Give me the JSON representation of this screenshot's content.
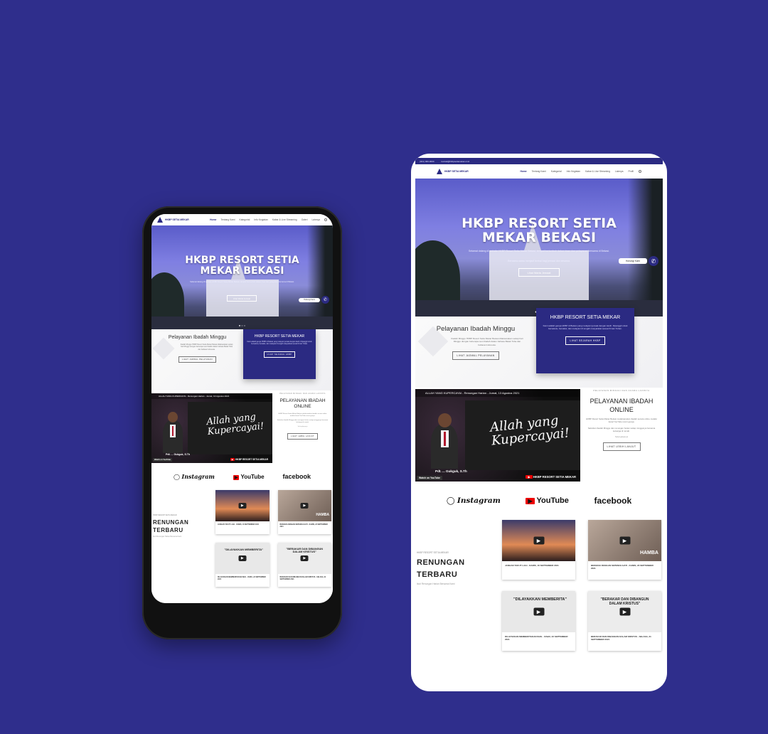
{
  "topbar": {
    "phone": "(021) 000-0000",
    "email": "kontak@hkbpsetiamekar.or.id"
  },
  "nav": {
    "logo": "HKBP SETIA MEKAR",
    "items": [
      "Home",
      "Tentang Kami",
      "Kategorial",
      "Info Kegiatan",
      "Renungan",
      "Kabar & Live Streaming",
      "Galeri",
      "Lainnya"
    ],
    "tablet_items": [
      "Home",
      "Tentang Kami",
      "Kategorial",
      "Info Kegiatan",
      "Kabar & Live Streaming",
      "Lainnya",
      "Profil"
    ]
  },
  "hero": {
    "title_line1": "HKBP RESORT SETIA",
    "title_line2": "MEKAR BEKASI",
    "subtitle": "Selamat datang di website HKBP Resort Setia Mekar Bekasi, tempat bertumbuh dalam iman dan pelayanan bersama di Bekasi.",
    "sub2": "Bersama-sama menjadi berkat bagi jemaat dan sesama.",
    "button": "Lihat Warta Jemaat",
    "whatsapp": "Hubungi Kami"
  },
  "service": {
    "left_title": "Pelayanan Ibadah Minggu",
    "left_text": "Ibadah Minggu HKBP Resort Setia Mekar Bekasi dilaksanakan setiap hari Minggu dengan beberapa sesi ibadah dalam bahasa Batak Toba dan bahasa Indonesia.",
    "left_button": "LIHAT JADWAL PELAYANAN",
    "card_title": "HKBP RESORT SETIA MEKAR",
    "card_text": "Kami adalah gereja HKBP di Bekasi yang melayani jemaat dengan kasih. Dipanggil untuk bersekutu, bersaksi, dan melayani di tengah masyarakat sesuai firman Tuhan.",
    "card_button": "LIHAT SEJARAH HKBP"
  },
  "video": {
    "title": "ALLAH YANG KUPERCAYAI  -  Renungan Harian - Jumat, 13 Agustus 2021",
    "script_line1": "Allah yang",
    "script_line2": "Kupercayai!",
    "speaker": "Pdt. ... Gukguk, S.Th",
    "channel": "HKBP RESORT SETIA MEKAR",
    "watch_on": "Watch on",
    "youtube": "YouTube"
  },
  "online": {
    "kicker": "PELAYANAN MINGGU DAN ACARA LAINNYA",
    "title_line1": "PELAYANAN IBADAH",
    "title_line2": "ONLINE",
    "text1": "HKBP Resort Setia Mekar Bekasi melaksanakan ibadah secara online melalui kanal YouTube resmi gereja.",
    "text2": "Saksikan ibadah Minggu dan renungan harian setiap minggunya bersama keluarga di rumah.",
    "label": "Selengkapnya",
    "button": "LIHAT LEBIH LANJUT"
  },
  "socials": {
    "instagram": "Instagram",
    "youtube": "YouTube",
    "facebook": "facebook"
  },
  "reflections": {
    "kicker": "HKBP RESORT SETIA MEKAR",
    "title_line1": "RENUNGAN",
    "title_line2": "TERBARU",
    "subtitle": "Ikuti Renungan Harian Bersama Kami",
    "cards": [
      {
        "caption": "JANGAN TAKUT LAGI - KAMIS, 16 SEPTEMBER 2021",
        "overlay": ""
      },
      {
        "caption": "BEKERJA DENGAN SEPENUH HATI - KAMIS, 23 SEPTEMBER 2021",
        "overlay": "HAMBA"
      },
      {
        "caption": "DILAYAKKAN MEMBERITAKAN INJIL - RABU, 22 SEPTEMBER 2021",
        "overlay": "\"DILAYAKKAN MEMBERITA\""
      },
      {
        "caption": "BERAKAR DAN DIBANGUN DALAM KRISTUS - SELASA, 21 SEPTEMBER 2021",
        "overlay": "\"BERAKAR DAN DIBANGUN DALAM KRISTUS\""
      }
    ]
  },
  "colors": {
    "background": "#2f2e8c",
    "primary": "#2b2a82",
    "youtube_red": "#e00000"
  }
}
